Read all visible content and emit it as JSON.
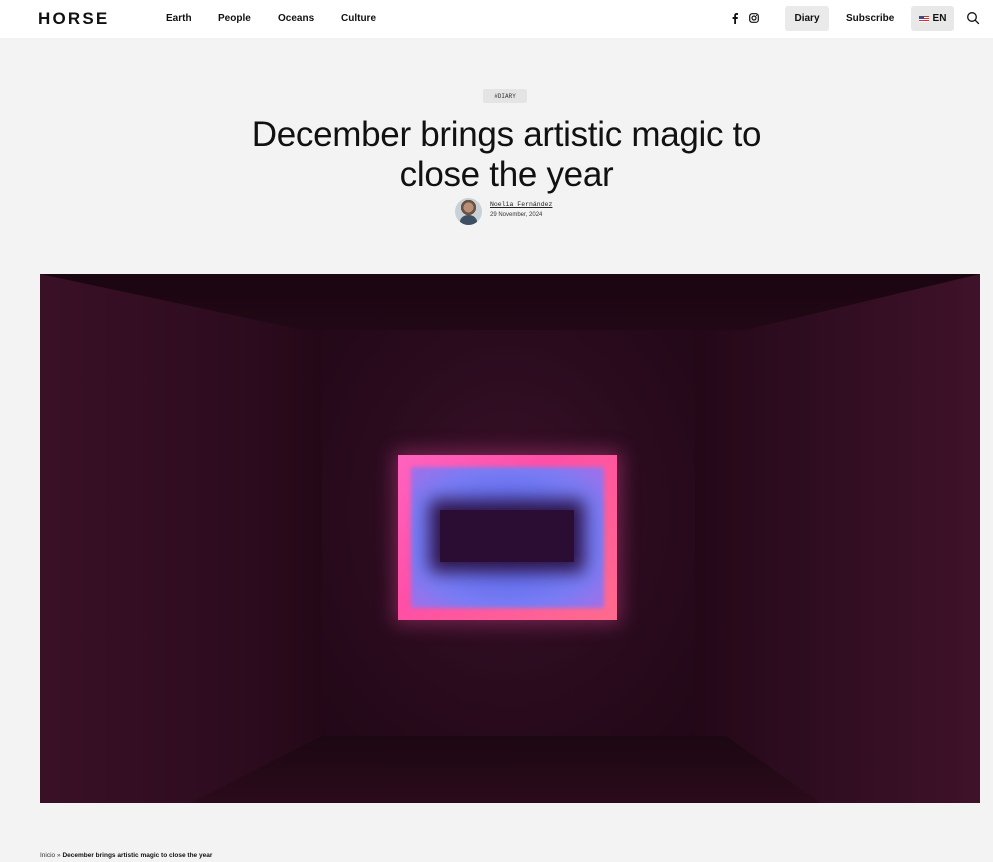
{
  "header": {
    "logo": "HORSE",
    "nav": [
      "Earth",
      "People",
      "Oceans",
      "Culture"
    ],
    "diary_label": "Diary",
    "subscribe_label": "Subscribe",
    "lang_label": "EN"
  },
  "article": {
    "tag": "#DIARY",
    "title": "December brings artistic magic to close the year",
    "author": "Noelia Fernández",
    "date": "29 November, 2024"
  },
  "breadcrumb": {
    "home": "Inicio",
    "separator": "»",
    "current": "December brings artistic magic to close the year"
  },
  "icons": {
    "facebook": "facebook-icon",
    "instagram": "instagram-icon",
    "search": "search-icon",
    "flag": "us-flag-icon"
  },
  "colors": {
    "background": "#f3f3f3",
    "header": "#ffffff",
    "accent_pink": "#ff4fa6",
    "accent_blue": "#6873f0"
  }
}
